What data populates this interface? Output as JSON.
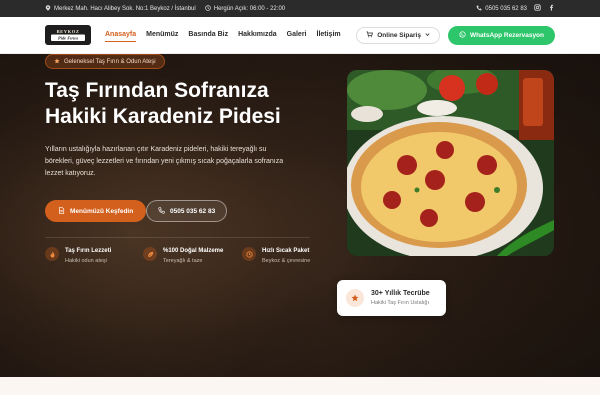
{
  "topbar": {
    "address": "Merkez Mah. Hacı Alibey Sok. No:1 Beykoz / İstanbul",
    "hours": "Hergün Açık: 06:00 - 22:00",
    "phone": "0505 035 62 83",
    "icons": [
      "location-pin-icon",
      "clock-icon",
      "phone-icon",
      "instagram-icon",
      "facebook-icon"
    ]
  },
  "nav": {
    "logo_text": "BEYKOZ Pide Fırını",
    "items": [
      {
        "label": "Anasayfa",
        "active": true
      },
      {
        "label": "Menümüz",
        "active": false
      },
      {
        "label": "Basında Biz",
        "active": false
      },
      {
        "label": "Hakkımızda",
        "active": false
      },
      {
        "label": "Galeri",
        "active": false
      },
      {
        "label": "İletişim",
        "active": false
      }
    ],
    "order_button": "Online Sipariş",
    "whatsapp_button": "WhatsApp Rezervasyon"
  },
  "hero": {
    "badge": "Geleneksel Taş Fırın & Odun Ateşi",
    "title_line1": "Taş Fırından Sofranıza",
    "title_line2": "Hakiki Karadeniz Pidesi",
    "lead": "Yılların ustalığıyla hazırlanan çıtır Karadeniz pideleri, hakiki tereyağlı su börekleri, güveç lezzetleri ve fırından yeni çıkmış sıcak poğaçalarla sofranıza lezzet katıyoruz.",
    "primary_button": "Menümüzü Keşfedin",
    "phone_button": "0505 035 62 83",
    "features": [
      {
        "title": "Taş Fırın Lezzeti",
        "subtitle": "Hakiki odun ateşi",
        "icon": "flame-icon"
      },
      {
        "title": "%100 Doğal Malzeme",
        "subtitle": "Tereyağlı & taze",
        "icon": "leaf-icon"
      },
      {
        "title": "Hızlı Sıcak Paket",
        "subtitle": "Beykoz & çevresine",
        "icon": "clock-icon"
      }
    ],
    "experience": {
      "title": "30+ Yıllık Tecrübe",
      "subtitle": "Hakiki Taş Fırın Ustalığı",
      "icon": "star-icon"
    }
  },
  "colors": {
    "accent": "#d3601c",
    "whatsapp": "#2ec66b",
    "topbar": "#2b2b2b"
  }
}
